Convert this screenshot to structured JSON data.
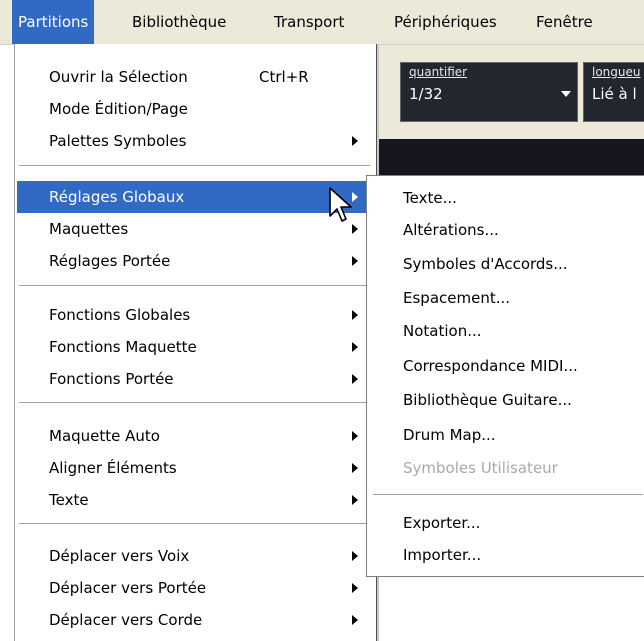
{
  "menubar": {
    "items": [
      {
        "label": "Partitions",
        "active": true
      },
      {
        "label": "Bibliothèque"
      },
      {
        "label": "Transport"
      },
      {
        "label": "Périphériques"
      },
      {
        "label": "Fenêtre"
      }
    ]
  },
  "toolbar": {
    "quantifier_label": "quantifier",
    "quantifier_value": "1/32",
    "longueur_label": "longueu",
    "longueur_value": "Lié à l"
  },
  "menu": {
    "items": [
      {
        "label": "Ouvrir la Sélection",
        "shortcut": "Ctrl+R"
      },
      {
        "label": "Mode Édition/Page"
      },
      {
        "label": "Palettes Symboles",
        "submenu": true
      },
      {
        "label": "Réglages Globaux",
        "submenu": true,
        "highlighted": true
      },
      {
        "label": "Maquettes",
        "submenu": true
      },
      {
        "label": "Réglages Portée",
        "submenu": true
      },
      {
        "label": "Fonctions Globales",
        "submenu": true
      },
      {
        "label": "Fonctions Maquette",
        "submenu": true
      },
      {
        "label": "Fonctions Portée",
        "submenu": true
      },
      {
        "label": "Maquette Auto",
        "submenu": true
      },
      {
        "label": "Aligner Éléments",
        "submenu": true
      },
      {
        "label": "Texte",
        "submenu": true
      },
      {
        "label": "Déplacer vers Voix",
        "submenu": true
      },
      {
        "label": "Déplacer vers Portée",
        "submenu": true
      },
      {
        "label": "Déplacer vers Corde",
        "submenu": true
      }
    ]
  },
  "submenu": {
    "items": [
      {
        "label": "Texte..."
      },
      {
        "label": "Altérations..."
      },
      {
        "label": "Symboles d'Accords..."
      },
      {
        "label": "Espacement..."
      },
      {
        "label": "Notation..."
      },
      {
        "label": "Correspondance MIDI..."
      },
      {
        "label": "Bibliothèque Guitare..."
      },
      {
        "label": "Drum Map..."
      },
      {
        "label": "Symboles Utilisateur",
        "disabled": true
      },
      {
        "label": "Exporter..."
      },
      {
        "label": "Importer..."
      }
    ]
  },
  "colors": {
    "highlight": "#316ac5",
    "menubar_bg": "#ece9d8",
    "disabled_text": "#a8a8a8"
  },
  "cursor_icon": "arrow-pointer-icon",
  "submenu_arrow_icon": "triangle-right-icon"
}
